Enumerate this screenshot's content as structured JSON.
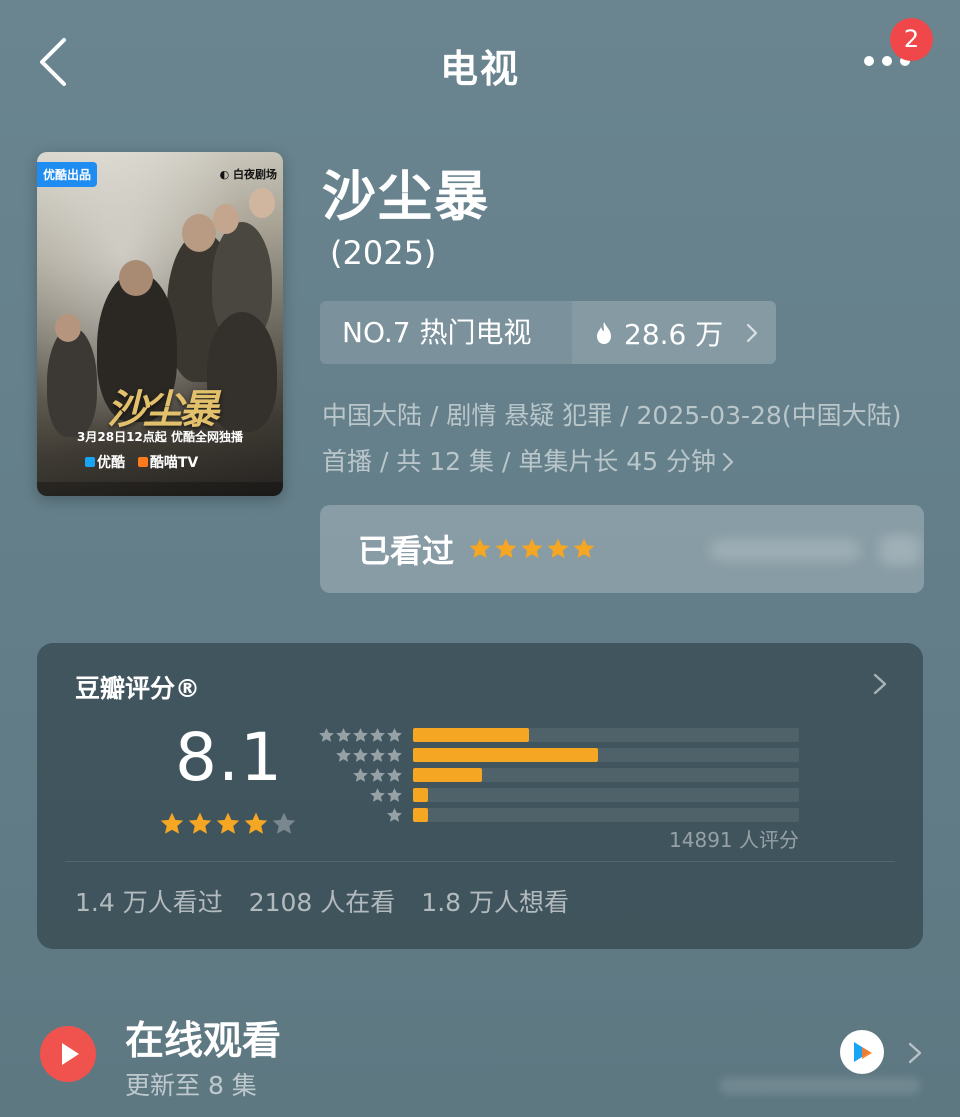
{
  "topbar": {
    "title": "电视",
    "notification_count": "2"
  },
  "poster": {
    "tag": "优酷出品",
    "studio": "◐ 白夜剧场",
    "title_art": "沙尘暴",
    "release_line": "3月28日12点起 优酷全网独播",
    "platform_1": "优酷",
    "platform_2": "酷喵TV"
  },
  "show": {
    "title": "沙尘暴",
    "year": "(2025)",
    "rank": "NO.7 热门电视",
    "heat": "28.6 万",
    "meta": "中国大陆 / 剧情 悬疑 犯罪 / 2025-03-28(中国大陆) 首播 / 共 12 集 / 单集片长 45 分钟",
    "watched_label": "已看过",
    "my_rating_stars": 5
  },
  "rating": {
    "title": "豆瓣评分®",
    "score": "8.1",
    "score_stars": 4,
    "distribution": [
      {
        "stars": 5,
        "percent": 30
      },
      {
        "stars": 4,
        "percent": 48
      },
      {
        "stars": 3,
        "percent": 18
      },
      {
        "stars": 2,
        "percent": 4
      },
      {
        "stars": 1,
        "percent": 4
      }
    ],
    "raters": "14891 人评分",
    "watched": "1.4 万人看过",
    "watching": "2108 人在看",
    "want": "1.8 万人想看"
  },
  "watch": {
    "title": "在线观看",
    "subtitle": "更新至 8 集"
  },
  "colors": {
    "accent_star": "#f5a623",
    "play_red": "#f0524d",
    "badge_red": "#f0484a"
  }
}
